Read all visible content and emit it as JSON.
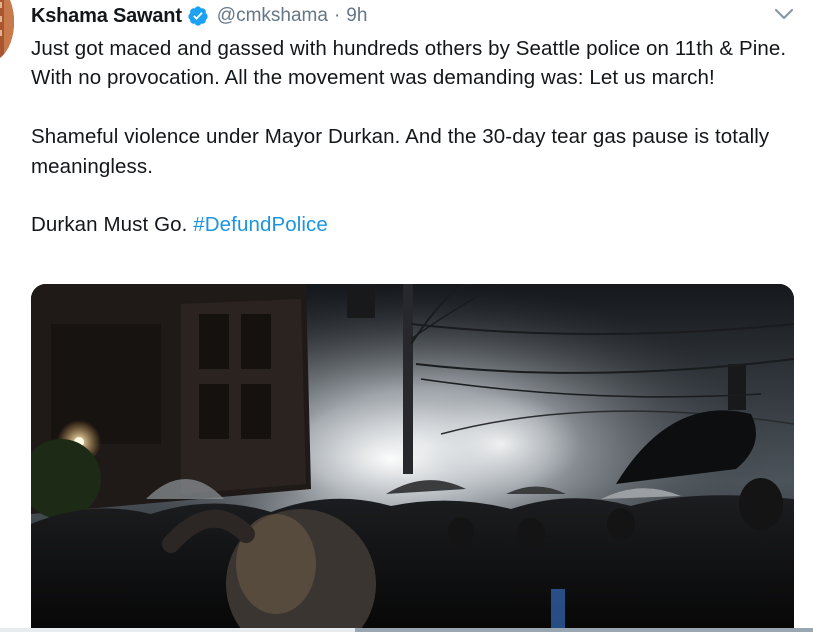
{
  "tweet": {
    "author_name": "Kshama Sawant",
    "handle": "@cmkshama",
    "separator": "·",
    "time": "9h",
    "paragraphs": [
      "Just got maced and gassed with hundreds others by Seattle police on 11th & Pine. With no provocation. All the movement was demanding was: Let us march!",
      "Shameful violence under Mayor Durkan. And the 30-day tear gas pause is totally meaningless."
    ],
    "last_line_text": "Durkan Must Go. ",
    "hashtag": "#DefundPolice"
  },
  "icons": {
    "verified": "verified-badge-icon",
    "more": "chevron-down-icon"
  },
  "colors": {
    "text": "#14171a",
    "secondary": "#657786",
    "link": "#1b95e0",
    "verified": "#1da1f2"
  }
}
